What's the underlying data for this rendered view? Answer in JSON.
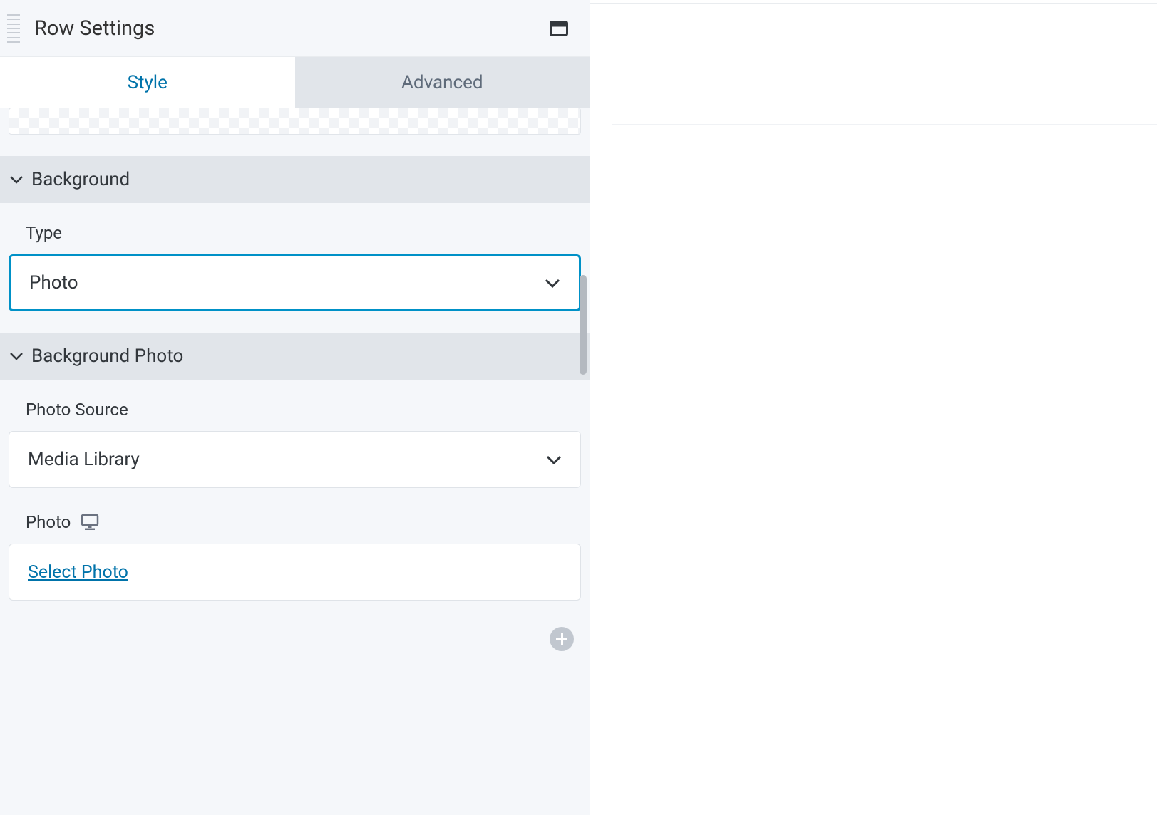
{
  "header": {
    "title": "Row Settings"
  },
  "tabs": {
    "style": "Style",
    "advanced": "Advanced",
    "active": "style"
  },
  "sections": {
    "background": {
      "title": "Background",
      "type_label": "Type",
      "type_value": "Photo"
    },
    "background_photo": {
      "title": "Background Photo",
      "source_label": "Photo Source",
      "source_value": "Media Library",
      "photo_label": "Photo",
      "select_photo": "Select Photo"
    }
  }
}
